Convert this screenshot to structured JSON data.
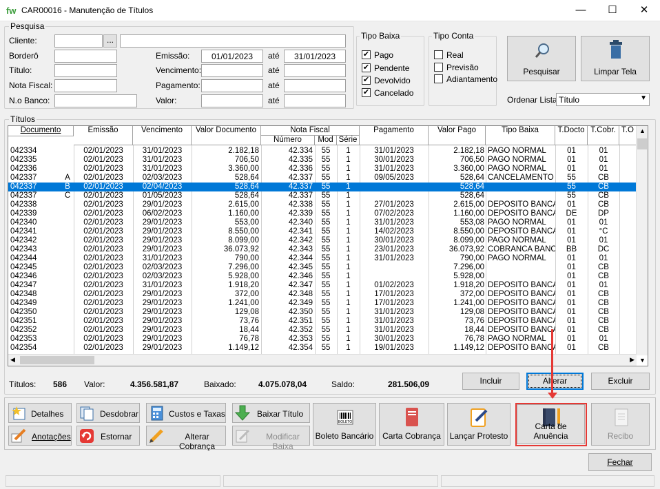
{
  "window": {
    "logo": "fw",
    "title": "CAR00016 - Manutenção de Títulos",
    "minimize": "—",
    "maximize": "☐",
    "close": "✕"
  },
  "pesquisa": {
    "legend": "Pesquisa",
    "cliente_label": "Cliente:",
    "cliente_btn": "...",
    "bordero_label": "Borderô",
    "titulo_label": "Título:",
    "nota_label": "Nota Fiscal:",
    "banco_label": "N.o Banco:",
    "emissao_label": "Emissão:",
    "emissao_de": "01/01/2023",
    "ate": "até",
    "emissao_ate": "31/01/2023",
    "vencimento_label": "Vencimento:",
    "pagamento_label": "Pagamento:",
    "valor_label": "Valor:"
  },
  "tipo_baixa": {
    "legend": "Tipo Baixa",
    "items": [
      {
        "label": "Pago",
        "checked": "✔"
      },
      {
        "label": "Pendente",
        "checked": "✔"
      },
      {
        "label": "Devolvido",
        "checked": "✔"
      },
      {
        "label": "Cancelado",
        "checked": "✔"
      }
    ]
  },
  "tipo_conta": {
    "legend": "Tipo Conta",
    "items": [
      {
        "label": "Real",
        "checked": ""
      },
      {
        "label": "Previsão",
        "checked": ""
      },
      {
        "label": "Adiantamento",
        "checked": ""
      }
    ]
  },
  "buttons": {
    "pesquisar": "Pesquisar",
    "limpar": "Limpar Tela",
    "ordenar_label": "Ordenar Lista:",
    "ordenar_value": "Título",
    "incluir": "Incluir",
    "alterar": "Alterar",
    "excluir": "Excluir",
    "fechar": "Fechar"
  },
  "titulos": {
    "legend": "Títulos",
    "headers": {
      "documento": "Documento",
      "emissao": "Emissão",
      "vencimento": "Vencimento",
      "valor_doc": "Valor Documento",
      "nota_fiscal": "Nota Fiscal",
      "numero": "Número",
      "mod": "Mod",
      "serie": "Série",
      "pagamento": "Pagamento",
      "valor_pago": "Valor Pago",
      "tipo_baixa": "Tipo Baixa",
      "t_docto": "T.Docto",
      "t_cobr": "T.Cobr.",
      "t_o": "T.O"
    },
    "rows": [
      [
        "042334",
        "",
        "02/01/2023",
        "31/01/2023",
        "2.182,18",
        "42.334",
        "55",
        "1",
        "31/01/2023",
        "2.182,18",
        "PAGO NORMAL",
        "01",
        "01"
      ],
      [
        "042335",
        "",
        "02/01/2023",
        "31/01/2023",
        "706,50",
        "42.335",
        "55",
        "1",
        "30/01/2023",
        "706,50",
        "PAGO NORMAL",
        "01",
        "01"
      ],
      [
        "042336",
        "",
        "02/01/2023",
        "31/01/2023",
        "3.360,00",
        "42.336",
        "55",
        "1",
        "31/01/2023",
        "3.360,00",
        "PAGO NORMAL",
        "01",
        "01"
      ],
      [
        "042337",
        "A",
        "02/01/2023",
        "02/03/2023",
        "528,64",
        "42.337",
        "55",
        "1",
        "09/05/2023",
        "528,64",
        "CANCELAMENTO",
        "55",
        "CB"
      ],
      [
        "042337",
        "B",
        "02/01/2023",
        "02/04/2023",
        "528,64",
        "42.337",
        "55",
        "1",
        "",
        "528,64",
        "",
        "55",
        "CB"
      ],
      [
        "042337",
        "C",
        "02/01/2023",
        "01/05/2023",
        "528,64",
        "42.337",
        "55",
        "1",
        "",
        "528,64",
        "",
        "55",
        "CB"
      ],
      [
        "042338",
        "",
        "02/01/2023",
        "29/01/2023",
        "2.615,00",
        "42.338",
        "55",
        "1",
        "27/01/2023",
        "2.615,00",
        "DEPOSITO BANCA",
        "01",
        "CB"
      ],
      [
        "042339",
        "",
        "02/01/2023",
        "06/02/2023",
        "1.160,00",
        "42.339",
        "55",
        "1",
        "07/02/2023",
        "1.160,00",
        "DEPOSITO BANCA",
        "DE",
        "DP"
      ],
      [
        "042340",
        "",
        "02/01/2023",
        "29/01/2023",
        "553,00",
        "42.340",
        "55",
        "1",
        "31/01/2023",
        "553,08",
        "PAGO NORMAL",
        "01",
        "01"
      ],
      [
        "042341",
        "",
        "02/01/2023",
        "29/01/2023",
        "8.550,00",
        "42.341",
        "55",
        "1",
        "14/02/2023",
        "8.550,00",
        "DEPOSITO BANCA",
        "01",
        "°C"
      ],
      [
        "042342",
        "",
        "02/01/2023",
        "29/01/2023",
        "8.099,00",
        "42.342",
        "55",
        "1",
        "30/01/2023",
        "8.099,00",
        "PAGO NORMAL",
        "01",
        "01"
      ],
      [
        "042343",
        "",
        "02/01/2023",
        "29/01/2023",
        "36.073,92",
        "42.343",
        "55",
        "1",
        "23/01/2023",
        "36.073,92",
        "COBRANCA BANCA",
        "BB",
        "DC"
      ],
      [
        "042344",
        "",
        "02/01/2023",
        "31/01/2023",
        "790,00",
        "42.344",
        "55",
        "1",
        "31/01/2023",
        "790,00",
        "PAGO NORMAL",
        "01",
        "01"
      ],
      [
        "042345",
        "",
        "02/01/2023",
        "02/03/2023",
        "7.296,00",
        "42.345",
        "55",
        "1",
        "",
        "7.296,00",
        "",
        "01",
        "CB"
      ],
      [
        "042346",
        "",
        "02/01/2023",
        "02/03/2023",
        "5.928,00",
        "42.346",
        "55",
        "1",
        "",
        "5.928,00",
        "",
        "01",
        "CB"
      ],
      [
        "042347",
        "",
        "02/01/2023",
        "31/01/2023",
        "1.918,20",
        "42.347",
        "55",
        "1",
        "01/02/2023",
        "1.918,20",
        "DEPOSITO BANCA",
        "01",
        "01"
      ],
      [
        "042348",
        "",
        "02/01/2023",
        "29/01/2023",
        "372,00",
        "42.348",
        "55",
        "1",
        "17/01/2023",
        "372,00",
        "DEPOSITO BANCA",
        "01",
        "CB"
      ],
      [
        "042349",
        "",
        "02/01/2023",
        "29/01/2023",
        "1.241,00",
        "42.349",
        "55",
        "1",
        "17/01/2023",
        "1.241,00",
        "DEPOSITO BANCA",
        "01",
        "CB"
      ],
      [
        "042350",
        "",
        "02/01/2023",
        "29/01/2023",
        "129,08",
        "42.350",
        "55",
        "1",
        "31/01/2023",
        "129,08",
        "DEPOSITO BANCA",
        "01",
        "CB"
      ],
      [
        "042351",
        "",
        "02/01/2023",
        "29/01/2023",
        "73,76",
        "42.351",
        "55",
        "1",
        "31/01/2023",
        "73,76",
        "DEPOSITO BANCA",
        "01",
        "CB"
      ],
      [
        "042352",
        "",
        "02/01/2023",
        "29/01/2023",
        "18,44",
        "42.352",
        "55",
        "1",
        "31/01/2023",
        "18,44",
        "DEPOSITO BANCA",
        "01",
        "CB"
      ],
      [
        "042353",
        "",
        "02/01/2023",
        "29/01/2023",
        "76,78",
        "42.353",
        "55",
        "1",
        "30/01/2023",
        "76,78",
        "PAGO NORMAL",
        "01",
        "01"
      ],
      [
        "042354",
        "",
        "02/01/2023",
        "29/01/2023",
        "1.149,12",
        "42.354",
        "55",
        "1",
        "19/01/2023",
        "1.149,12",
        "DEPOSITO BANCA",
        "01",
        "CB"
      ]
    ],
    "selected_index": 4
  },
  "totals": {
    "titulos_label": "Títulos:",
    "titulos_value": "586",
    "valor_label": "Valor:",
    "valor_value": "4.356.581,87",
    "baixado_label": "Baixado:",
    "baixado_value": "4.075.078,04",
    "saldo_label": "Saldo:",
    "saldo_value": "281.506,09"
  },
  "actions": {
    "detalhes": "Detalhes",
    "desdobrar": "Desdobrar",
    "custos": "Custos e Taxas",
    "baixar": "Baixar Título",
    "anotacoes": "Anotações",
    "estornar": "Estornar",
    "alterar_cobranca": "Alterar Cobrança",
    "modificar_baixa": "Modificar Baixa",
    "boleto": "Boleto Bancário",
    "boleto_icon_text": "BOLETO",
    "carta_cobranca": "Carta Cobrança",
    "lancar_protesto": "Lançar Protesto",
    "carta_anuencia": "Carta de Anuência",
    "recibo": "Recibo"
  },
  "colors": {
    "selection": "#0078d7",
    "highlight": "#e53935"
  }
}
